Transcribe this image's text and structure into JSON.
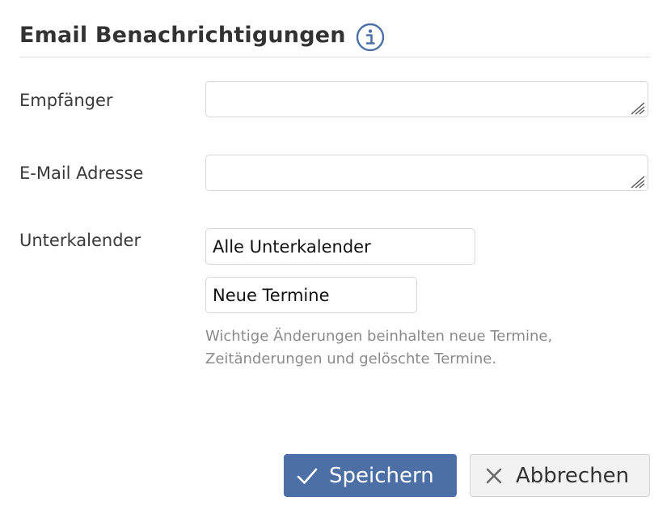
{
  "dialog": {
    "title": "Email Benachrichtigungen",
    "info_icon": "info-icon"
  },
  "fields": {
    "recipient": {
      "label": "Empfänger",
      "value": "",
      "placeholder": ""
    },
    "email": {
      "label": "E-Mail Adresse",
      "value": "",
      "placeholder": ""
    },
    "subcalendar": {
      "label": "Unterkalender",
      "selected": "Alle Unterkalender"
    },
    "notification_type": {
      "selected": "Neue Termine"
    },
    "help_text": "Wichtige Änderungen beinhalten neue Termine, Zeitänderungen und gelöschte Termine."
  },
  "actions": {
    "save_label": "Speichern",
    "save_icon": "check-icon",
    "cancel_label": "Abbrechen",
    "cancel_icon": "close-icon"
  },
  "colors": {
    "primary": "#4c70a6",
    "info_icon": "#4c70a6",
    "help_text": "#8a8a8a"
  }
}
